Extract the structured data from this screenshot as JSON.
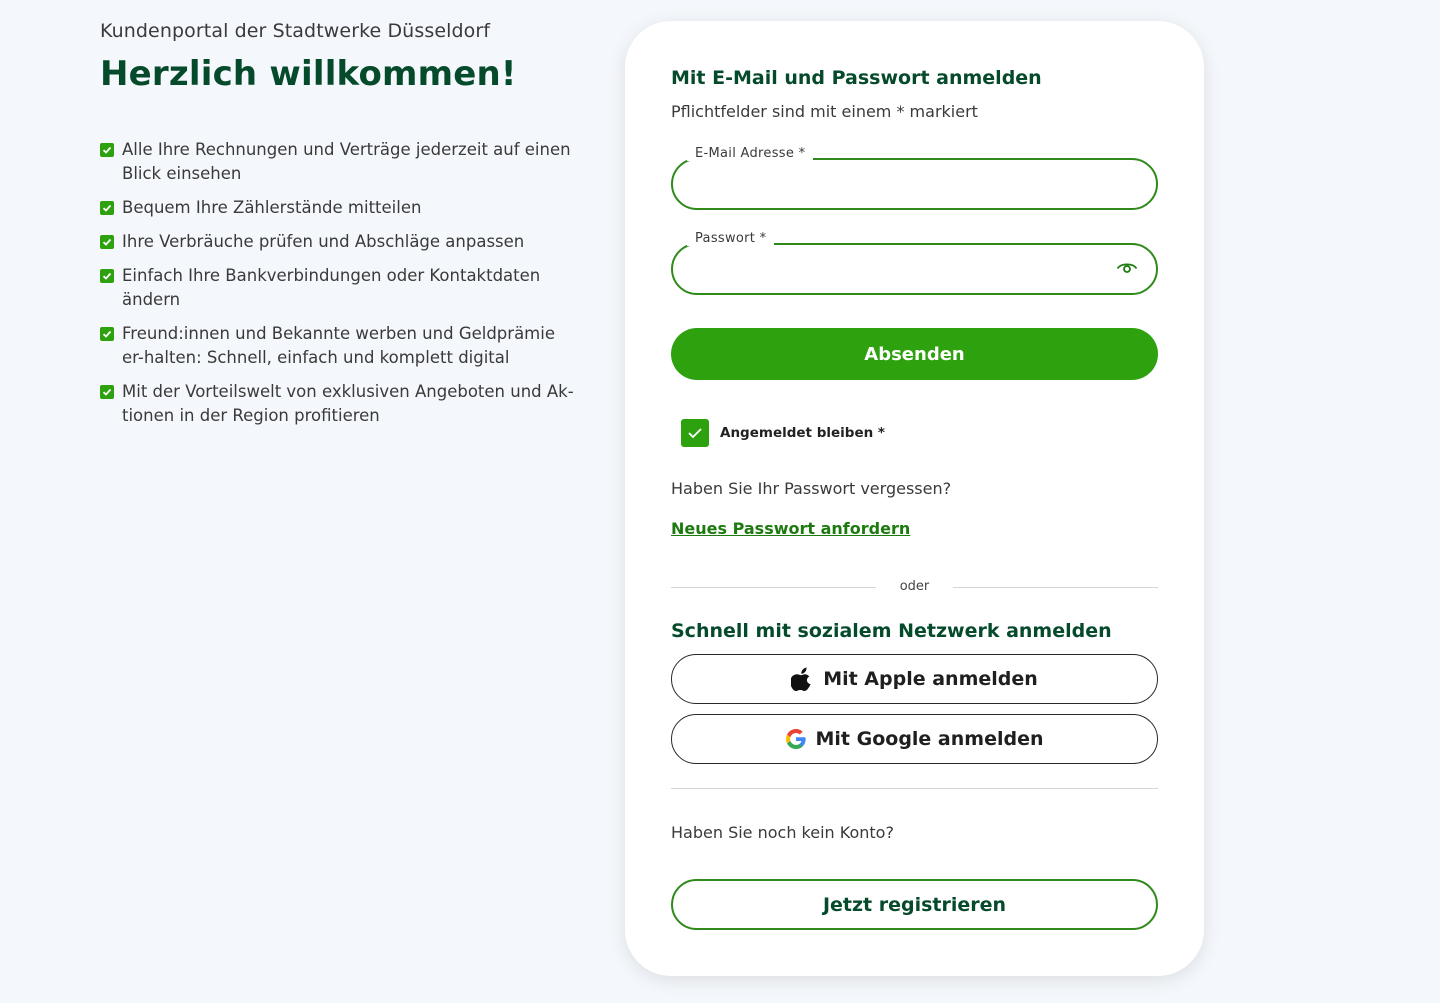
{
  "intro": {
    "portal_title": "Kundenportal der Stadtwerke Düsseldorf",
    "welcome": "Herzlich willkommen!",
    "benefits": [
      "Alle Ihre Rechnungen und Verträge jederzeit auf einen Blick einsehen",
      "Bequem Ihre Zählerstände mitteilen",
      "Ihre Verbräuche prüfen und Abschläge anpassen",
      "Einfach Ihre Bankverbindungen oder Kontaktdaten ändern",
      "Freund:innen und Bekannte werben und Geldprämie er-halten: Schnell, einfach und komplett digital",
      "Mit der Vorteilswelt von exklusiven Angeboten und Ak-tionen in der Region profitieren"
    ]
  },
  "login": {
    "heading": "Mit E-Mail und Passwort anmelden",
    "required_note": "Pflichtfelder sind mit einem * markiert",
    "email_label": "E-Mail Adresse *",
    "email_value": "",
    "password_label": "Passwort *",
    "password_value": "",
    "submit_label": "Absenden",
    "remember_label": "Angemeldet bleiben *",
    "remember_checked": true,
    "forgot_question": "Haben Sie Ihr Passwort vergessen?",
    "forgot_link": "Neues Passwort anfordern"
  },
  "divider_text": "oder",
  "social": {
    "heading": "Schnell mit sozialem Netzwerk anmelden",
    "apple_label": "Mit Apple anmelden",
    "google_label": "Mit Google anmelden"
  },
  "register": {
    "question": "Haben Sie noch kein Konto?",
    "button_label": "Jetzt registrieren"
  },
  "icons": {
    "benefit_check": "checkbox-checked-icon",
    "password_toggle": "eye-icon",
    "apple": "apple-icon",
    "google": "google-icon"
  },
  "colors": {
    "brand_green": "#2ea10f",
    "dark_green": "#064a2c",
    "background": "#f4f7fb"
  }
}
